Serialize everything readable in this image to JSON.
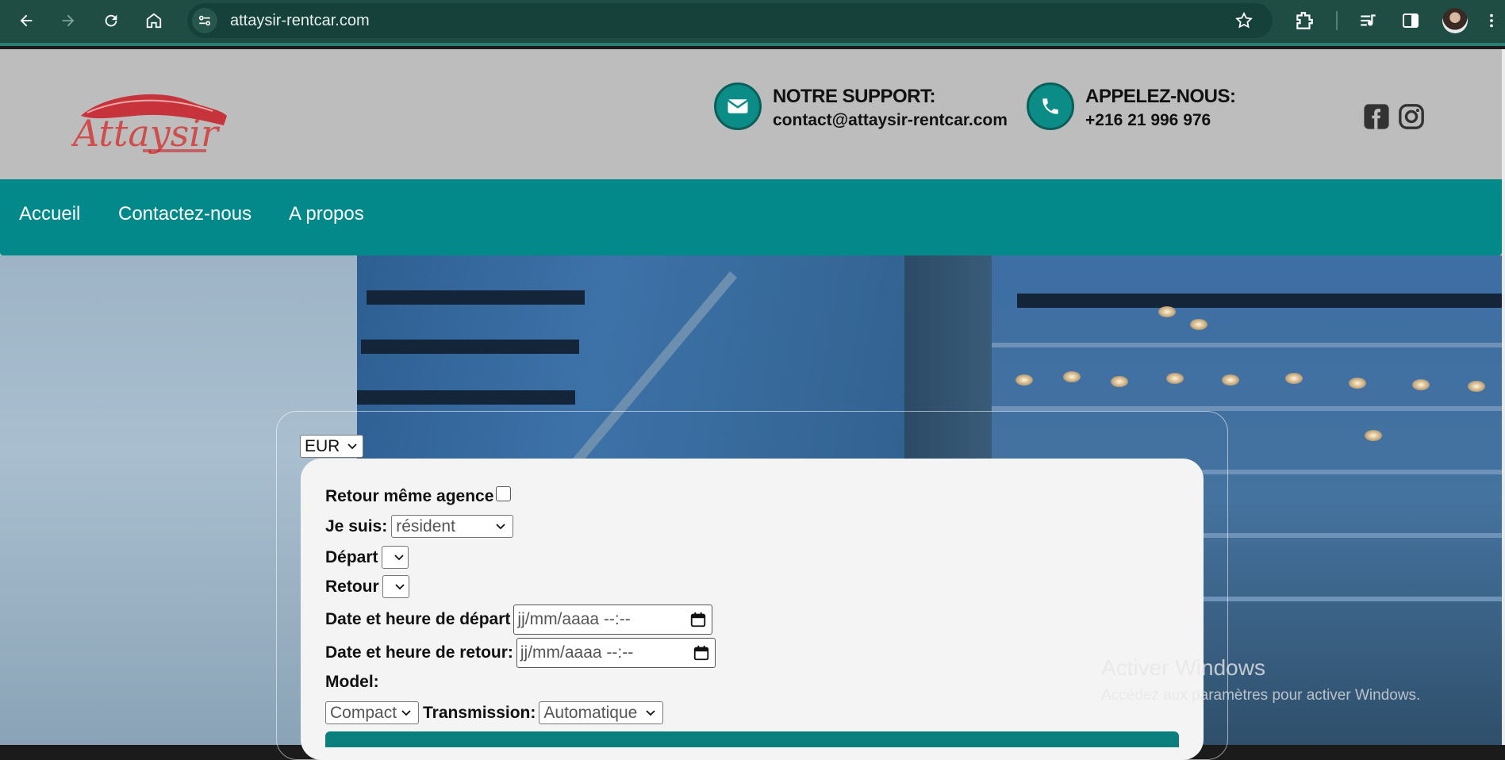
{
  "browser": {
    "url": "attaysir-rentcar.com",
    "icons": [
      "back-icon",
      "forward-icon",
      "reload-icon",
      "home-icon",
      "site-info-icon",
      "bookmark-star-icon",
      "extensions-icon",
      "media-icon",
      "side-panel-icon",
      "profile-avatar",
      "menu-icon"
    ]
  },
  "header": {
    "logo_text": "Attaysir",
    "support": {
      "title": "NOTRE SUPPORT:",
      "value": "contact@attaysir-rentcar.com"
    },
    "phone": {
      "title": "APPELEZ-NOUS:",
      "value": "+216 21 996 976"
    },
    "social": [
      "facebook-icon",
      "instagram-icon"
    ]
  },
  "nav": {
    "items": [
      {
        "label": "Accueil"
      },
      {
        "label": "Contactez-nous"
      },
      {
        "label": "A propos"
      }
    ]
  },
  "booking": {
    "currency": "EUR",
    "same_agency_label": "Retour même agence",
    "same_agency_checked": false,
    "i_am_label": "Je suis:",
    "i_am_value": "résident",
    "departure_label": "Départ",
    "departure_value": "",
    "return_label": "Retour",
    "return_value": "",
    "departure_datetime_label": "Date et heure de départ",
    "return_datetime_label": "Date et heure de retour:",
    "datetime_placeholder": "jj/mm/aaaa --:--",
    "model_label": "Model:",
    "model_value": "Compact",
    "transmission_label": "Transmission:",
    "transmission_value": "Automatique"
  },
  "watermark": {
    "title": "Activer Windows",
    "subtitle": "Accédez aux paramètres pour activer Windows."
  },
  "colors": {
    "chrome_bg": "#1f4d44",
    "teal": "#03898a",
    "header_bg": "#bdbdbd"
  }
}
